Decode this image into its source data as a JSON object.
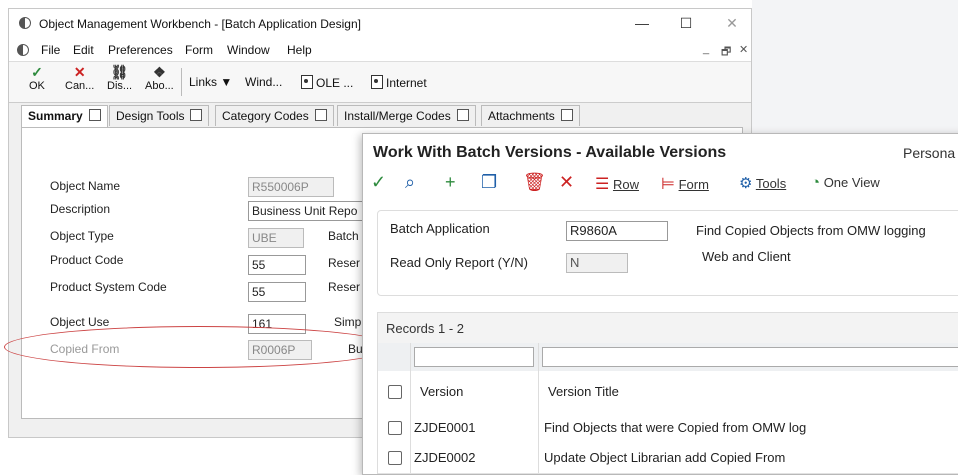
{
  "back_window": {
    "title": "Object Management Workbench - [Batch Application Design]",
    "window_controls": {
      "minimize": "—",
      "maximize": "☐",
      "close": "✕"
    },
    "menu": [
      "File",
      "Edit",
      "Preferences",
      "Form",
      "Window",
      "Help"
    ],
    "mdi_controls": {
      "minimize": "_",
      "restore": "🗗",
      "close": "✕"
    },
    "toolbar": {
      "ok": "OK",
      "cancel": "Can...",
      "display": "Dis...",
      "about": "Abo...",
      "links": "Links",
      "window": "Wind...",
      "ole": "OLE ...",
      "internet": "Internet"
    },
    "tabs": [
      "Summary",
      "Design Tools",
      "Category Codes",
      "Install/Merge Codes",
      "Attachments"
    ],
    "form": {
      "object_name_label": "Object Name",
      "object_name_value": "R550006P",
      "description_label": "Description",
      "description_value": "Business Unit Repo",
      "object_type_label": "Object Type",
      "object_type_value": "UBE",
      "object_type_right": "Batch",
      "product_code_label": "Product Code",
      "product_code_value": "55",
      "product_code_right": "Reser",
      "product_system_code_label": "Product System Code",
      "product_system_code_value": "55",
      "product_system_code_right": "Reser",
      "object_use_label": "Object Use",
      "object_use_value": "161",
      "object_use_right": "Simp",
      "copied_from_label": "Copied From",
      "copied_from_value": "R0006P",
      "copied_from_right": "Bu"
    },
    "highlight_color": "#c44444"
  },
  "front_panel": {
    "title": "Work With Batch Versions - Available Versions",
    "personalize": "Persona",
    "toolbar": {
      "row": "Row",
      "form": "Form",
      "tools": "Tools",
      "one_view": "One View"
    },
    "batch_application_label": "Batch Application",
    "batch_application_value": "R9860A",
    "batch_application_desc": "Find Copied Objects from OMW logging",
    "read_only_label": "Read Only Report (Y/N)",
    "read_only_value": "N",
    "platform": "Web and Client",
    "records": "Records 1 - 2",
    "columns": [
      "Version",
      "Version Title"
    ],
    "rows": [
      {
        "version": "ZJDE0001",
        "title": "Find Objects that were Copied from OMW log"
      },
      {
        "version": "ZJDE0002",
        "title": "Update Object Librarian add Copied From"
      }
    ],
    "accent_green": "#2e8b3e",
    "accent_red": "#cc2222",
    "accent_blue": "#1f5fa8"
  }
}
